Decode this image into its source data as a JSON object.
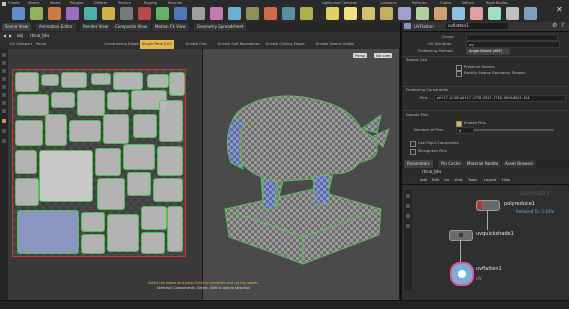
{
  "header": {
    "tabs": [
      "Create",
      "Modify",
      "Model",
      "Polygon",
      "Deform",
      "Texture",
      "Rigging",
      "Muscles"
    ],
    "right_tabs": [
      "Lights and Cameras",
      "Collisions",
      "Particles",
      "Grains",
      "Vellum",
      "Rigid Bodies"
    ]
  },
  "main_tabs": [
    "Scene View",
    "Animation Editor",
    "Render View",
    "Composite View",
    "Motion FX View",
    "Geometry Spreadsheet"
  ],
  "path": {
    "root": "obj",
    "node": "rhino_bhs"
  },
  "viewport": {
    "left_label": "UV Viewport",
    "left_mode": "Persp",
    "right_label": "Single Pane (UV)",
    "toolbar_items": [
      "Constraining Edges",
      "Single Pane (UV)",
      "Enable Flex",
      "Enable Soft Boundaries",
      "Enable Cutting Edges",
      "Enable Seams Visible"
    ],
    "persp": "Persp",
    "cam": "No cam",
    "hint": "Select the edges and press Enter to complete and cut the seams.",
    "hint2": "Selection Components: Select, Shift to add to selection"
  },
  "params": {
    "header_title": "UVFlatten",
    "node_name": "uvflatten1",
    "group_label": "Group",
    "uv_attribute_label": "UV Attribute",
    "uv_attribute_value": "uv",
    "flatten_method_label": "Flattening Method",
    "flatten_method_value": "Angle-Based (ABF)",
    "seams_label": "Seams Grp",
    "preserve_label": "Preserve Seams",
    "rectify_label": "Rectify Seams Boundary Shapes",
    "pinning_label": "Flattening Constraints",
    "pin_label": "Pins",
    "pin_value": "p0+17 -0.105 p0+17 -1778 -5917 -7718 -9519-8513 -104",
    "islands_label": "Islands Pins",
    "enable_pins": "Enable Pins",
    "num_pins_label": "Number of Pins",
    "num_pins_value": "0",
    "enable_seams": "Use Rigid Constraints",
    "straighten": "Straighten Pins"
  },
  "network": {
    "tabs": [
      "Parameters",
      "Pin Cache",
      "Material Palette",
      "Asset Browser"
    ],
    "path": "rhino_bhs",
    "menu": [
      "Add",
      "Edit",
      "Go",
      "View",
      "Tools",
      "Layout",
      "Help"
    ],
    "context_label": "Geometry",
    "nodes": [
      {
        "name": "polyreduce1",
        "note": "Reduced To: 5.43%"
      },
      {
        "name": "uvquickshade1",
        "note": ""
      },
      {
        "name": "uvflatten1",
        "note": "UV"
      }
    ]
  },
  "colors": {
    "accent": "#e6b84a",
    "uv_edge": "#4ec84e",
    "selection": "#6a7fd8",
    "bound_red": "#cc3333"
  }
}
